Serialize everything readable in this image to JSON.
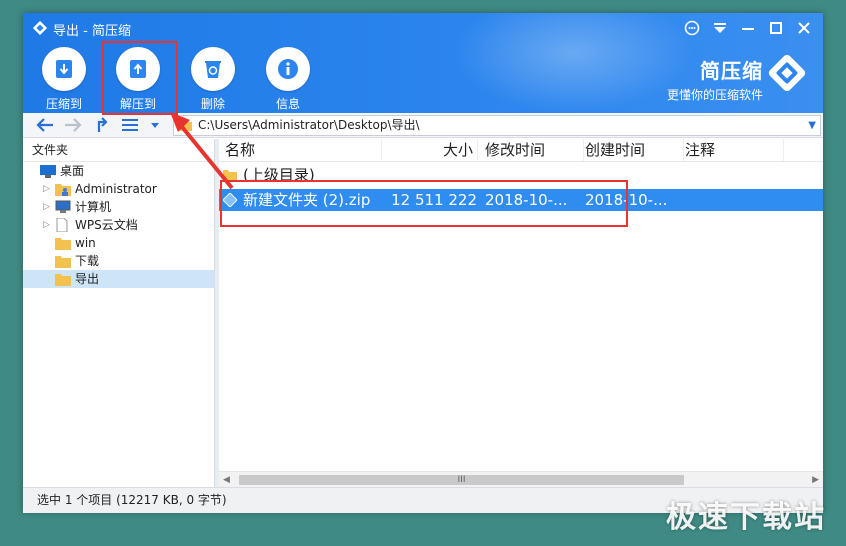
{
  "window": {
    "title": "导出 - 简压缩",
    "controls": [
      "feedback-icon",
      "menu-icon",
      "minimize-icon",
      "maximize-icon",
      "close-icon"
    ]
  },
  "toolbar": {
    "compress_label": "压缩到",
    "extract_label": "解压到",
    "delete_label": "删除",
    "info_label": "信息"
  },
  "brand": {
    "name": "简压缩",
    "slogan": "更懂你的压缩软件"
  },
  "address": {
    "path": "C:\\Users\\Administrator\\Desktop\\导出\\"
  },
  "sidebar": {
    "header": "文件夹",
    "items": [
      {
        "label": "桌面",
        "icon": "desktop-icon"
      },
      {
        "label": "Administrator",
        "icon": "user-folder-icon"
      },
      {
        "label": "计算机",
        "icon": "computer-icon"
      },
      {
        "label": "WPS云文档",
        "icon": "document-icon"
      },
      {
        "label": "win",
        "icon": "folder-icon"
      },
      {
        "label": "下载",
        "icon": "folder-icon"
      },
      {
        "label": "导出",
        "icon": "folder-icon"
      }
    ]
  },
  "files": {
    "columns": [
      "名称",
      "大小",
      "修改时间",
      "创建时间",
      "注释"
    ],
    "rows": [
      {
        "name": "(上级目录)",
        "size": "",
        "modified": "",
        "created": ""
      },
      {
        "name": "新建文件夹 (2).zip",
        "size": "12 511 222",
        "modified": "2018-10-...",
        "created": "2018-10-..."
      }
    ]
  },
  "status": {
    "text": "选中 1 个项目 (12217 KB, 0 字节)"
  },
  "scrollbar": {
    "grip": "III"
  },
  "watermark": "极速下载站",
  "colors": {
    "titlebar": "#2c85ee",
    "selection": "#2f8cf0",
    "annotation": "#e8342f"
  }
}
